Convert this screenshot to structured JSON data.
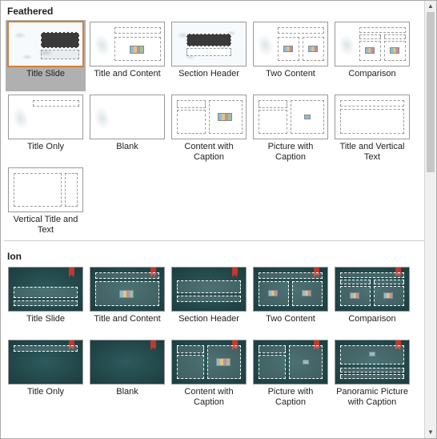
{
  "sections": [
    {
      "title": "Feathered",
      "theme": "feathered",
      "layouts": [
        {
          "label": "Title Slide",
          "kind": "title",
          "selected": true
        },
        {
          "label": "Title and Content",
          "kind": "title-content"
        },
        {
          "label": "Section Header",
          "kind": "section-header"
        },
        {
          "label": "Two Content",
          "kind": "two-content"
        },
        {
          "label": "Comparison",
          "kind": "comparison"
        },
        {
          "label": "Title Only",
          "kind": "title-only"
        },
        {
          "label": "Blank",
          "kind": "blank"
        },
        {
          "label": "Content with Caption",
          "kind": "content-caption"
        },
        {
          "label": "Picture with Caption",
          "kind": "picture-caption"
        },
        {
          "label": "Title and Vertical Text",
          "kind": "title-vtext"
        },
        {
          "label": "Vertical Title and Text",
          "kind": "vtitle-text"
        }
      ]
    },
    {
      "title": "Ion",
      "theme": "ion",
      "layouts": [
        {
          "label": "Title Slide",
          "kind": "title"
        },
        {
          "label": "Title and Content",
          "kind": "title-content"
        },
        {
          "label": "Section Header",
          "kind": "section-header"
        },
        {
          "label": "Two Content",
          "kind": "two-content"
        },
        {
          "label": "Comparison",
          "kind": "comparison"
        },
        {
          "label": "Title Only",
          "kind": "title-only"
        },
        {
          "label": "Blank",
          "kind": "blank"
        },
        {
          "label": "Content with Caption",
          "kind": "content-caption"
        },
        {
          "label": "Picture with Caption",
          "kind": "picture-caption"
        },
        {
          "label": "Panoramic Picture with Caption",
          "kind": "panoramic"
        }
      ]
    }
  ]
}
